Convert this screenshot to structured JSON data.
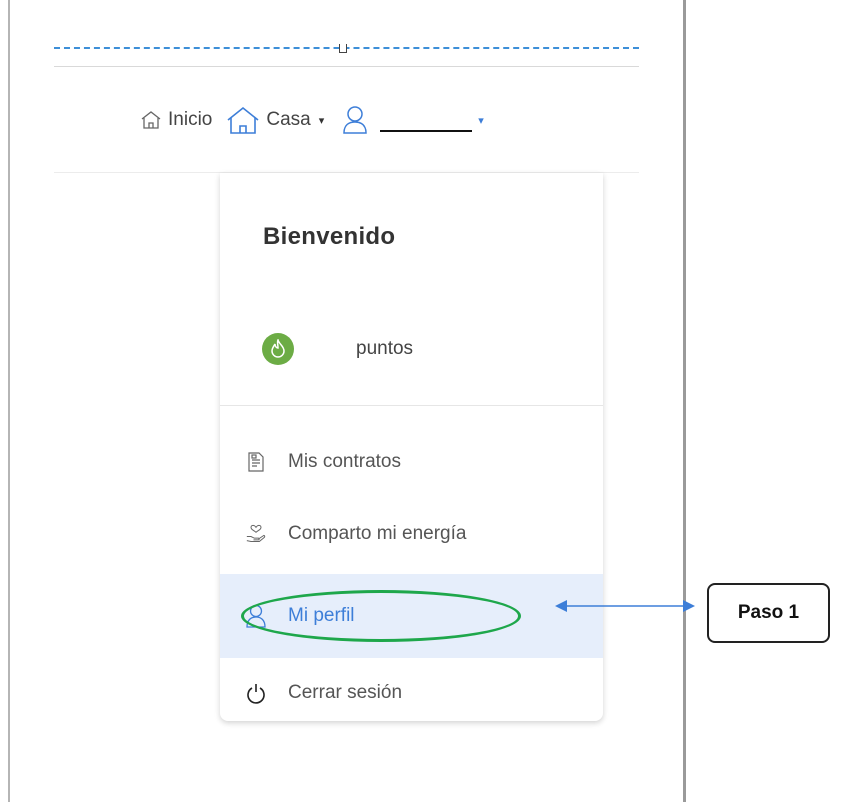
{
  "nav": {
    "inicio_label": "Inicio",
    "casa_label": "Casa",
    "casa_caret": "▾",
    "user_caret": "▾"
  },
  "menu": {
    "welcome": "Bienvenido",
    "points_label": "puntos",
    "items": [
      {
        "label": "Mis contratos",
        "icon": "contract-icon"
      },
      {
        "label": "Comparto mi energía",
        "icon": "share-energy-icon"
      },
      {
        "label": "Mi perfil",
        "icon": "user-icon",
        "active": true
      },
      {
        "label": "Cerrar sesión",
        "icon": "power-icon"
      }
    ]
  },
  "annotation": {
    "step_label": "Paso 1",
    "oval_color": "#1ea74b",
    "arrow_color": "#3d7ed8"
  },
  "colors": {
    "accent": "#3d7ed8",
    "points_badge": "#6cac45",
    "active_bg": "#e6eefb"
  }
}
